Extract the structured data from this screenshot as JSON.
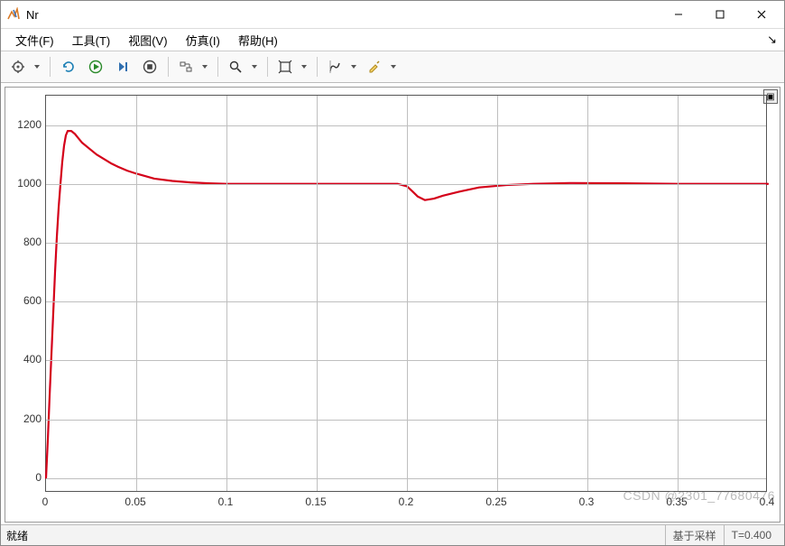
{
  "window": {
    "title": "Nr"
  },
  "menu": {
    "items": [
      {
        "label": "文件(F)"
      },
      {
        "label": "工具(T)"
      },
      {
        "label": "视图(V)"
      },
      {
        "label": "仿真(I)"
      },
      {
        "label": "帮助(H)"
      }
    ]
  },
  "toolbar": {
    "icons": {
      "settings": "gear-icon",
      "build": "build-icon",
      "run": "run-icon",
      "step": "step-icon",
      "stop": "stop-icon",
      "signal": "signal-icon",
      "zoom": "zoom-icon",
      "pan": "pan-icon",
      "cursor": "cursor-icon",
      "highlight": "highlight-icon"
    }
  },
  "statusbar": {
    "ready": "就绪",
    "sampletype": "基于采样",
    "time": "T=0.400"
  },
  "watermark": "CSDN @2301_77680476",
  "chart_data": {
    "type": "line",
    "title": "",
    "xlabel": "",
    "ylabel": "",
    "xlim": [
      0,
      0.4
    ],
    "ylim": [
      -50,
      1300
    ],
    "xticks": [
      0,
      0.05,
      0.1,
      0.15,
      0.2,
      0.25,
      0.3,
      0.35,
      0.4
    ],
    "yticks": [
      0,
      200,
      400,
      600,
      800,
      1000,
      1200
    ],
    "series": [
      {
        "name": "Nr",
        "color": "#d4001a",
        "x": [
          0,
          0.001,
          0.002,
          0.003,
          0.004,
          0.005,
          0.006,
          0.007,
          0.008,
          0.009,
          0.01,
          0.011,
          0.012,
          0.014,
          0.016,
          0.018,
          0.02,
          0.024,
          0.028,
          0.032,
          0.036,
          0.04,
          0.045,
          0.05,
          0.06,
          0.07,
          0.08,
          0.09,
          0.1,
          0.12,
          0.14,
          0.16,
          0.18,
          0.195,
          0.2,
          0.203,
          0.206,
          0.21,
          0.215,
          0.22,
          0.23,
          0.24,
          0.255,
          0.27,
          0.29,
          0.32,
          0.35,
          0.38,
          0.4
        ],
        "y": [
          0,
          130,
          280,
          420,
          560,
          700,
          820,
          920,
          1000,
          1075,
          1130,
          1165,
          1180,
          1180,
          1170,
          1155,
          1140,
          1120,
          1100,
          1085,
          1070,
          1058,
          1045,
          1035,
          1018,
          1010,
          1005,
          1002,
          1000,
          1000,
          1000,
          1000,
          1000,
          1000,
          992,
          975,
          957,
          945,
          950,
          960,
          975,
          988,
          996,
          1000,
          1003,
          1002,
          1000,
          1000,
          1000
        ]
      }
    ]
  }
}
